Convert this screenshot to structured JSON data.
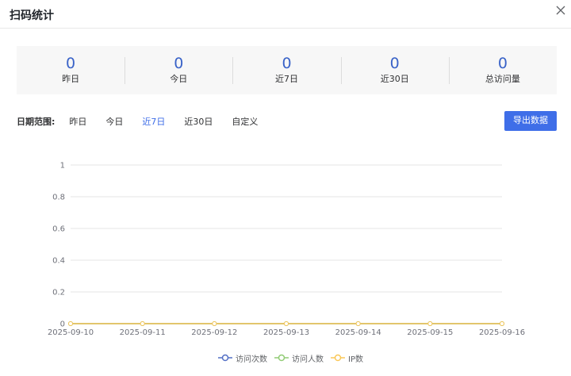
{
  "dialog": {
    "title": "扫码统计"
  },
  "stats": [
    {
      "value": "0",
      "label": "昨日"
    },
    {
      "value": "0",
      "label": "今日"
    },
    {
      "value": "0",
      "label": "近7日"
    },
    {
      "value": "0",
      "label": "近30日"
    },
    {
      "value": "0",
      "label": "总访问量"
    }
  ],
  "range": {
    "label": "日期范围:",
    "options": [
      "昨日",
      "今日",
      "近7日",
      "近30日",
      "自定义"
    ],
    "selected": "近7日"
  },
  "export_label": "导出数据",
  "colors": {
    "accent": "#3f6ee8",
    "series_visits": "#5470c6",
    "series_visitors": "#91cc75",
    "series_ip": "#fac858"
  },
  "chart_data": {
    "type": "line",
    "categories": [
      "2025-09-10",
      "2025-09-11",
      "2025-09-12",
      "2025-09-13",
      "2025-09-14",
      "2025-09-15",
      "2025-09-16"
    ],
    "series": [
      {
        "name": "访问次数",
        "values": [
          0,
          0,
          0,
          0,
          0,
          0,
          0
        ]
      },
      {
        "name": "访问人数",
        "values": [
          0,
          0,
          0,
          0,
          0,
          0,
          0
        ]
      },
      {
        "name": "IP数",
        "values": [
          0,
          0,
          0,
          0,
          0,
          0,
          0
        ]
      }
    ],
    "yticks": [
      0,
      0.2,
      0.4,
      0.6,
      0.8,
      1
    ],
    "ylim": [
      0,
      1
    ],
    "grid": true,
    "legend": "bottom-center"
  }
}
